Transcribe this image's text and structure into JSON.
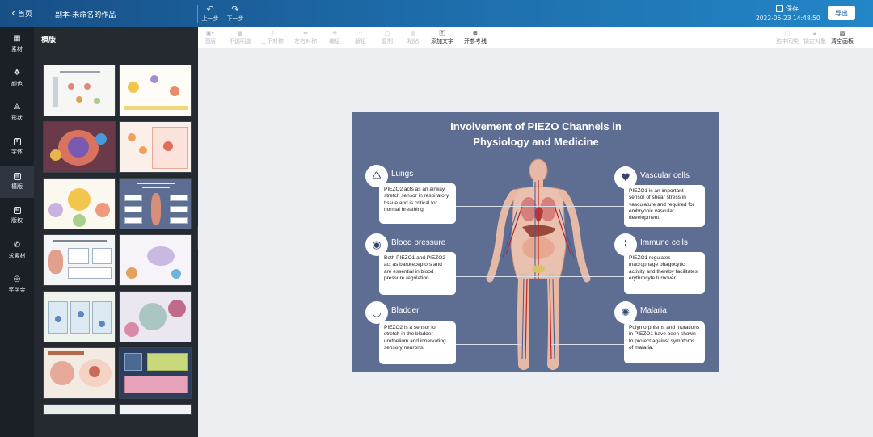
{
  "header": {
    "back_label": "首页",
    "title": "副本-未命名的作品",
    "undo_label": "上一步",
    "redo_label": "下一步",
    "save_label": "保存",
    "save_time": "2022-05-23 14:48:50",
    "export_label": "导出"
  },
  "rail": {
    "items": [
      {
        "label": "素材",
        "icon": "grid-icon"
      },
      {
        "label": "颜色",
        "icon": "palette-icon"
      },
      {
        "label": "形状",
        "icon": "shapes-icon"
      },
      {
        "label": "字体",
        "icon": "text-icon"
      },
      {
        "label": "模版",
        "icon": "template-icon"
      },
      {
        "label": "版权",
        "icon": "copyright-icon"
      },
      {
        "label": "求素材",
        "icon": "phone-icon"
      },
      {
        "label": "奖学金",
        "icon": "medal-icon"
      }
    ]
  },
  "panel": {
    "title": "模版"
  },
  "toolbar": {
    "items": [
      {
        "label": "图层",
        "enabled": false
      },
      {
        "label": "不透明度",
        "enabled": false
      },
      {
        "label": "上下对称",
        "enabled": false
      },
      {
        "label": "左右对称",
        "enabled": false
      },
      {
        "label": "编组",
        "enabled": false
      },
      {
        "label": "解组",
        "enabled": false
      },
      {
        "label": "复制",
        "enabled": false
      },
      {
        "label": "粘贴",
        "enabled": false
      },
      {
        "label": "添加文字",
        "enabled": true
      },
      {
        "label": "开参考线",
        "enabled": true
      }
    ],
    "right_items": [
      {
        "label": "选中同类",
        "enabled": false
      },
      {
        "label": "锁定对象",
        "enabled": false
      },
      {
        "label": "清空画板",
        "enabled": true
      }
    ]
  },
  "slide": {
    "title_line1": "Involvement of PIEZO Channels in",
    "title_line2": "Physiology and Medicine",
    "sections": [
      {
        "heading": "Lungs",
        "icon": "lungs-icon",
        "text": "PIEZO2 acts as an airway stretch sensor in respiratory tissue and is critical for normal breathing."
      },
      {
        "heading": "Blood pressure",
        "icon": "blood-pressure-icon",
        "text": "Both PIEZO1 and PIEZO2 act as baroreceptors and are essential in blood pressure regulation."
      },
      {
        "heading": "Bladder",
        "icon": "bladder-icon",
        "text": "PIEZO2 is a sensor for stretch in the bladder urothelium and innervating sensory neurons."
      },
      {
        "heading": "Vascular cells",
        "icon": "heart-icon",
        "text": "PIEZO1 is an important sensor of shear stress in vasculature and required for embryonic vascular development."
      },
      {
        "heading": "Immune cells",
        "icon": "dna-icon",
        "text": "PIEZO1 regulates macrophage phagocytic activity and thereby facilitates erythrocyte turnover."
      },
      {
        "heading": "Malaria",
        "icon": "virus-icon",
        "text": "Polymorphisms and mutations in PIEZO1 have been shown to protect against symptoms of malaria."
      }
    ]
  }
}
